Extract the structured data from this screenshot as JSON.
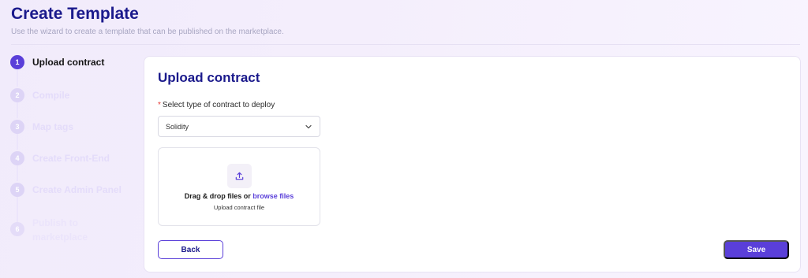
{
  "header": {
    "title": "Create Template",
    "subtitle": "Use the wizard to create a template that can be published on the marketplace."
  },
  "stepper": {
    "steps": [
      {
        "number": "1",
        "label": "Upload contract",
        "state": "active"
      },
      {
        "number": "2",
        "label": "Compile",
        "state": "inactive"
      },
      {
        "number": "3",
        "label": "Map tags",
        "state": "inactive"
      },
      {
        "number": "4",
        "label": "Create Front-End",
        "state": "inactive"
      },
      {
        "number": "5",
        "label": "Create Admin Panel",
        "state": "inactive"
      },
      {
        "number": "6",
        "label": "Publish to marketplace",
        "state": "inactive"
      }
    ]
  },
  "form": {
    "title": "Upload contract",
    "required_mark": "*",
    "contract_type_label": "Select type of contract to deploy",
    "contract_type_value": "Solidity",
    "dropzone": {
      "icon": "upload-icon",
      "text_prefix": "Drag & drop files or ",
      "browse_link": "browse files",
      "hint": "Upload contract file"
    },
    "back_label": "Back",
    "save_label": "Save"
  },
  "colors": {
    "accent": "#5a3fd9",
    "title": "#1b1a8c",
    "required": "#e53935"
  }
}
